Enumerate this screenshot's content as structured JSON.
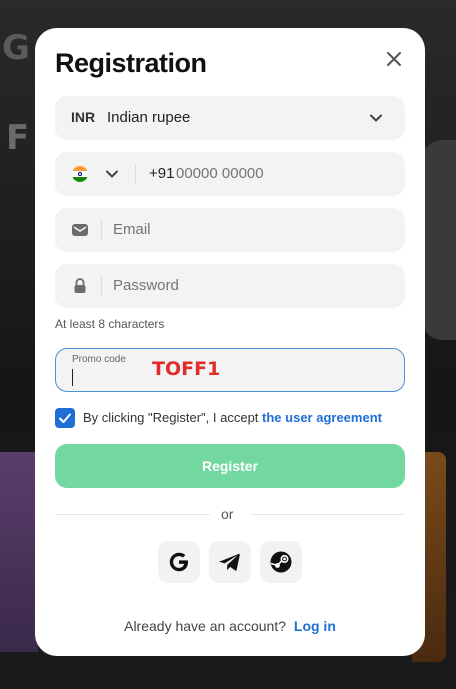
{
  "background": {
    "letters_top": "G",
    "letter_f": "F"
  },
  "modal": {
    "title": "Registration",
    "currency": {
      "code": "INR",
      "name": "Indian rupee"
    },
    "phone": {
      "prefix": "+91",
      "placeholder": "00000 00000"
    },
    "email": {
      "placeholder": "Email"
    },
    "password": {
      "placeholder": "Password",
      "hint": "At least 8 characters"
    },
    "promo": {
      "label": "Promo code",
      "value": "TOFF1"
    },
    "agreement": {
      "text": "By clicking \"Register\", I accept",
      "link": "the user agreement",
      "checked": true
    },
    "register_label": "Register",
    "or_label": "or",
    "social": [
      "google-icon",
      "telegram-icon",
      "steam-icon"
    ],
    "footer": {
      "text": "Already have an account?",
      "link": "Log in"
    }
  },
  "colors": {
    "accent": "#1d6fd6",
    "register_bg": "#73d89f",
    "promo_text": "#e22b2b"
  }
}
